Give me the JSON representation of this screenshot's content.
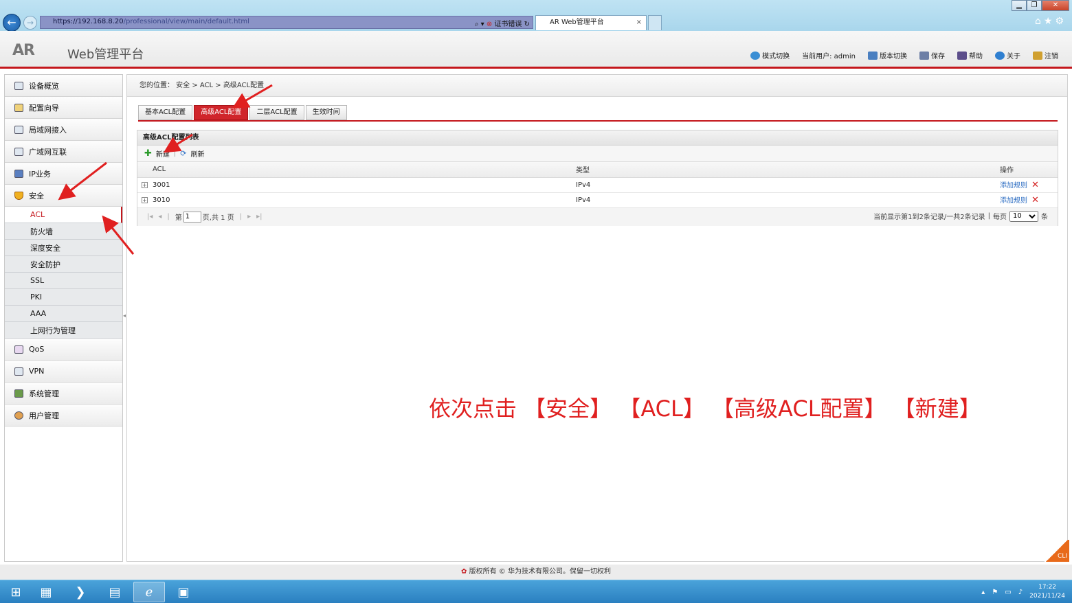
{
  "browser": {
    "url_host": "https://192.168.8.20",
    "url_path": "/professional/view/main/default.html",
    "cert_error": "证书错误",
    "tab_title": "AR Web管理平台"
  },
  "header": {
    "logo": "AR",
    "title": "Web管理平台",
    "tools": [
      {
        "label": "模式切换",
        "icon": "mode-switch-icon"
      },
      {
        "label": "当前用户: admin",
        "icon": ""
      },
      {
        "label": "版本切换",
        "icon": "version-switch-icon"
      },
      {
        "label": "保存",
        "icon": "save-icon"
      },
      {
        "label": "帮助",
        "icon": "help-icon"
      },
      {
        "label": "关于",
        "icon": "info-icon"
      },
      {
        "label": "注销",
        "icon": "logout-icon"
      }
    ]
  },
  "sidebar": {
    "items": [
      {
        "label": "设备概览"
      },
      {
        "label": "配置向导"
      },
      {
        "label": "局域网接入"
      },
      {
        "label": "广域网互联"
      },
      {
        "label": "IP业务"
      },
      {
        "label": "安全"
      }
    ],
    "security_sub": [
      {
        "label": "ACL"
      },
      {
        "label": "防火墙"
      },
      {
        "label": "深度安全"
      },
      {
        "label": "安全防护"
      },
      {
        "label": "SSL"
      },
      {
        "label": "PKI"
      },
      {
        "label": "AAA"
      },
      {
        "label": "上网行为管理"
      }
    ],
    "items_after": [
      {
        "label": "QoS"
      },
      {
        "label": "VPN"
      },
      {
        "label": "系统管理"
      },
      {
        "label": "用户管理"
      }
    ]
  },
  "main": {
    "breadcrumb": "您的位置： 安全 > ACL > 高级ACL配置",
    "tabs": [
      {
        "label": "基本ACL配置"
      },
      {
        "label": "高级ACL配置"
      },
      {
        "label": "二层ACL配置"
      },
      {
        "label": "生效时间"
      }
    ],
    "panel_title": "高级ACL配置列表",
    "new_label": "新建",
    "refresh_label": "刷新",
    "columns": {
      "acl": "ACL",
      "type": "类型",
      "op": "操作"
    },
    "rows": [
      {
        "acl": "3001",
        "type": "IPv4",
        "op": "添加规则"
      },
      {
        "acl": "3010",
        "type": "IPv4",
        "op": "添加规则"
      }
    ],
    "pager": {
      "prefix": "第",
      "page": "1",
      "suffix": "页,共 1 页",
      "summary": "当前显示第1到2条记录/一共2条记录",
      "per_page_label": "每页",
      "per_page": "10",
      "unit": "条"
    }
  },
  "annotation": "依次点击 【安全】 【ACL】 【高级ACL配置】 【新建】",
  "cli": "CLI",
  "footer": "版权所有 © 华为技术有限公司。保留一切权利",
  "clock": {
    "time": "17:22",
    "date": "2021/11/24"
  }
}
